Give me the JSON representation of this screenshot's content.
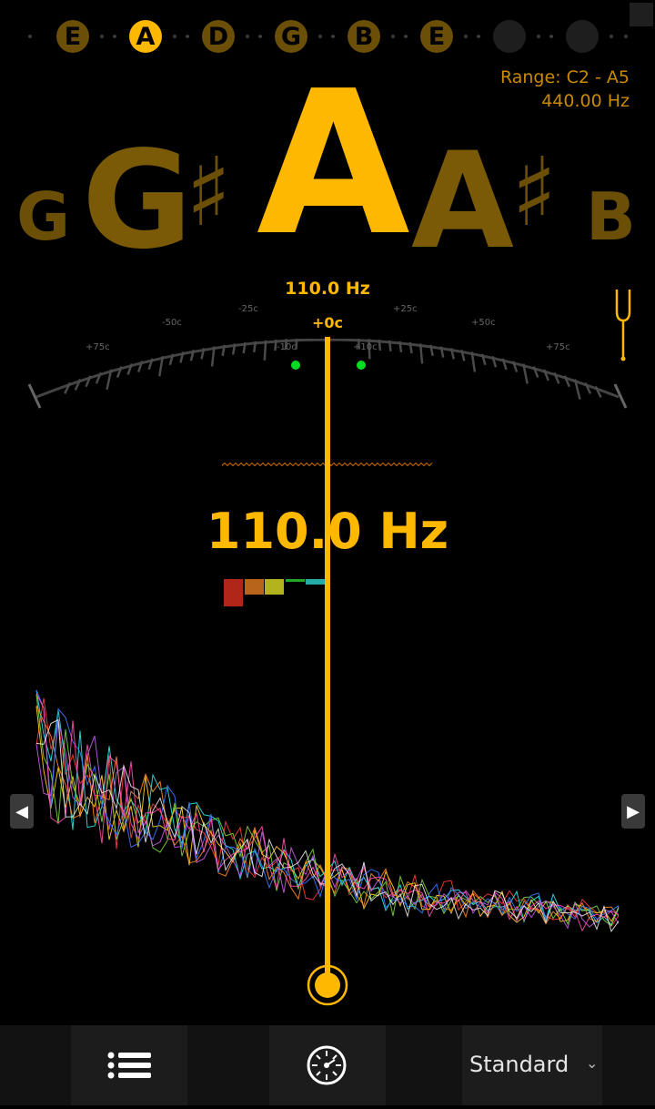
{
  "strings": [
    {
      "label": "E",
      "state": "dim"
    },
    {
      "label": "A",
      "state": "active"
    },
    {
      "label": "D",
      "state": "dim"
    },
    {
      "label": "G",
      "state": "dim"
    },
    {
      "label": "B",
      "state": "dim"
    },
    {
      "label": "E",
      "state": "dim"
    },
    {
      "label": "",
      "state": "empty"
    },
    {
      "label": "",
      "state": "empty"
    }
  ],
  "range": {
    "label": "Range: C2 - A5",
    "reference": "440.00 Hz"
  },
  "notes": {
    "far_left": "G",
    "left": "G",
    "left_sharp": "♯",
    "current": "A",
    "right": "A",
    "right_sharp": "♯",
    "far_right": "B"
  },
  "meter": {
    "frequency": "110.0 Hz",
    "cents": "+0c",
    "scale_labels": {
      "minus75": "+75c",
      "minus50": "-50c",
      "minus25": "-25c",
      "minus10": "-10c",
      "plus10": "+10c",
      "plus25": "+25c",
      "plus50": "+50c",
      "plus75": "+75c"
    }
  },
  "readout": {
    "frequency": "110.0 Hz"
  },
  "harmonic_bars": [
    {
      "color": "#b0271a",
      "level": 1.0
    },
    {
      "color": "#b8641a",
      "level": 0.55
    },
    {
      "color": "#b3b31e",
      "level": 0.55
    },
    {
      "color": "#1fa82a",
      "level": 0.1
    },
    {
      "color": "#25aaa8",
      "level": 0.2
    }
  ],
  "nav": {
    "prev_arrow": "◀",
    "next_arrow": "▶"
  },
  "toolbar": {
    "preset": "Standard",
    "preset_caret": "⌄"
  },
  "colors": {
    "accent": "#ffb800",
    "accent_dim": "#6b4f06",
    "in_tune_dot": "#00dd22",
    "background": "#000000"
  },
  "icons": [
    "list-icon",
    "settings-dial-icon",
    "tuning-fork-icon"
  ]
}
